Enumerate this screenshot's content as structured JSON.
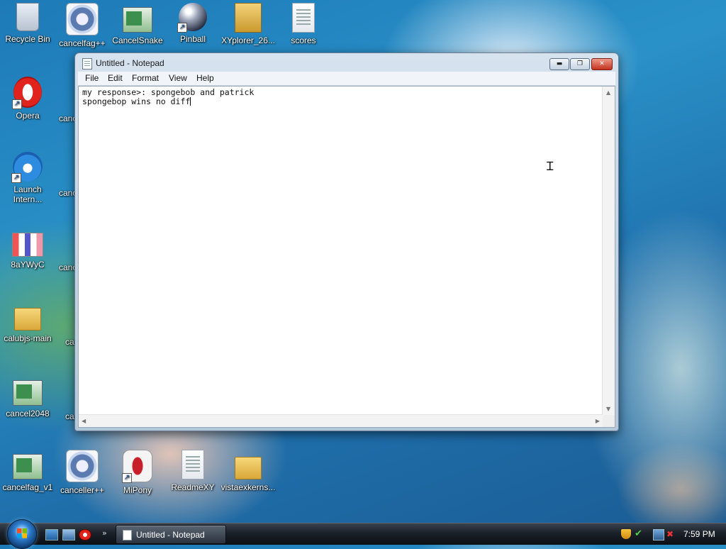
{
  "desktop": {
    "icons": [
      {
        "label": "Recycle Bin"
      },
      {
        "label": "cancelfag++"
      },
      {
        "label": "CancelSnake"
      },
      {
        "label": "Pinball"
      },
      {
        "label": "XYplorer_26..."
      },
      {
        "label": "scores"
      },
      {
        "label": "Opera"
      },
      {
        "label": "Launch Intern..."
      },
      {
        "label": "8aYWyC"
      },
      {
        "label": "calubjs-main"
      },
      {
        "label": "cancel2048"
      },
      {
        "label": "cancelfag_v1"
      },
      {
        "label": "canceller++"
      },
      {
        "label": "MiPony"
      },
      {
        "label": "ReadmeXY"
      },
      {
        "label": "vistaexkerns..."
      }
    ],
    "partial_labels": [
      "canc",
      "canc",
      "canc",
      "ca",
      "ca"
    ]
  },
  "notepad": {
    "title": "Untitled - Notepad",
    "caption_buttons": {
      "minimize": "▬",
      "maximize": "❐",
      "close": "✕"
    },
    "menu": [
      "File",
      "Edit",
      "Format",
      "View",
      "Help"
    ],
    "text_lines": [
      "my response>: spongebob and patrick",
      "spongebop wins no diff"
    ]
  },
  "taskbar": {
    "active_task": "Untitled - Notepad",
    "more_glyph": "»",
    "clock": "7:59 PM"
  },
  "icons": {
    "start": "windows-start-orb",
    "tray": [
      "security-shield-icon",
      "checkmark-icon",
      "network-icon",
      "volume-muted-icon"
    ]
  }
}
